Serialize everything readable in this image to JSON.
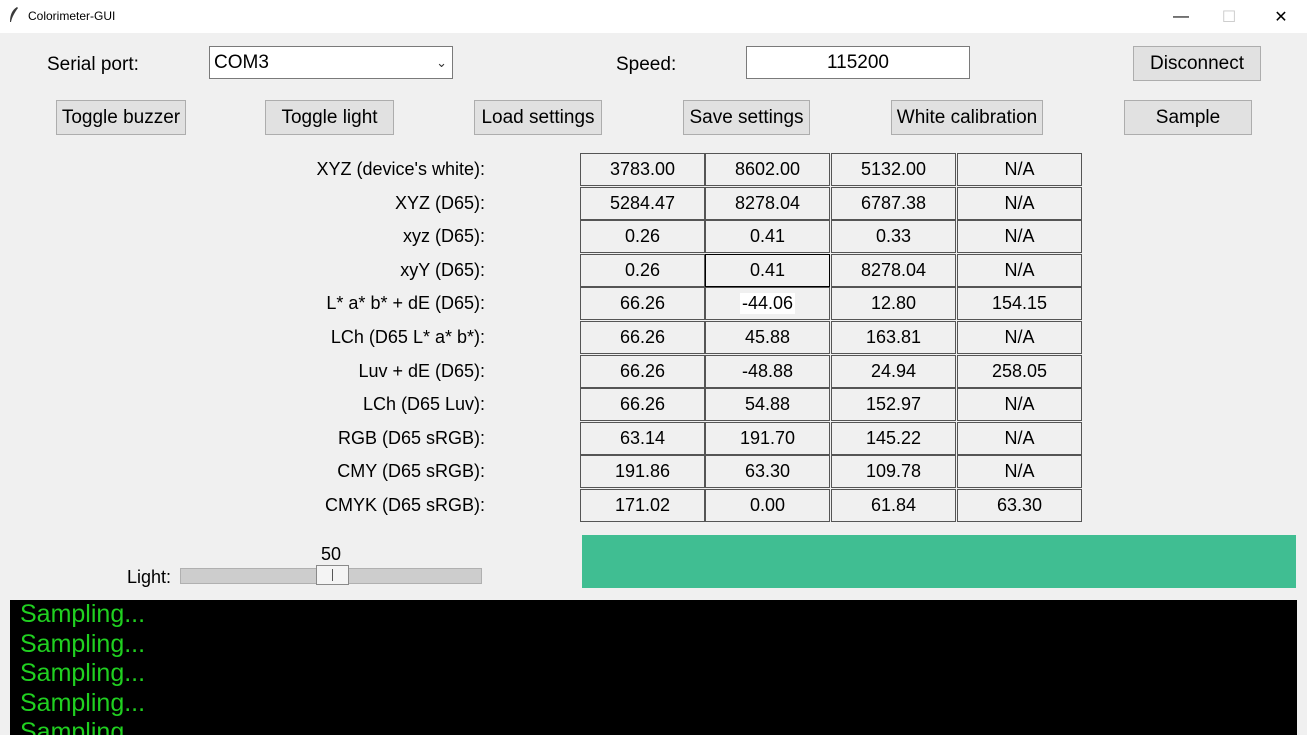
{
  "window": {
    "title": "Colorimeter-GUI",
    "minimize": "—",
    "maximize": "☐",
    "close": "✕"
  },
  "connection": {
    "serial_label": "Serial port:",
    "serial_value": "COM3",
    "speed_label": "Speed:",
    "speed_value": "115200",
    "disconnect": "Disconnect"
  },
  "buttons": {
    "toggle_buzzer": "Toggle buzzer",
    "toggle_light": "Toggle light",
    "load_settings": "Load settings",
    "save_settings": "Save settings",
    "white_calibration": "White calibration",
    "sample": "Sample"
  },
  "grid": {
    "rows": [
      {
        "label": "XYZ (device's white):",
        "values": [
          "3783.00",
          "8602.00",
          "5132.00",
          "N/A"
        ]
      },
      {
        "label": "XYZ (D65):",
        "values": [
          "5284.47",
          "8278.04",
          "6787.38",
          "N/A"
        ]
      },
      {
        "label": "xyz (D65):",
        "values": [
          "0.26",
          "0.41",
          "0.33",
          "N/A"
        ]
      },
      {
        "label": "xyY (D65):",
        "values": [
          "0.26",
          "0.41",
          "8278.04",
          "N/A"
        ]
      },
      {
        "label": "L* a* b* + dE (D65):",
        "values": [
          "66.26",
          "-44.06",
          "12.80",
          "154.15"
        ]
      },
      {
        "label": "LCh (D65 L* a* b*):",
        "values": [
          "66.26",
          "45.88",
          "163.81",
          "N/A"
        ]
      },
      {
        "label": "Luv + dE (D65):",
        "values": [
          "66.26",
          "-48.88",
          "24.94",
          "258.05"
        ]
      },
      {
        "label": "LCh (D65 Luv):",
        "values": [
          "66.26",
          "54.88",
          "152.97",
          "N/A"
        ]
      },
      {
        "label": "RGB (D65 sRGB):",
        "values": [
          "63.14",
          "191.70",
          "145.22",
          "N/A"
        ]
      },
      {
        "label": "CMY (D65 sRGB):",
        "values": [
          "191.86",
          "63.30",
          "109.78",
          "N/A"
        ]
      },
      {
        "label": "CMYK (D65 sRGB):",
        "values": [
          "171.02",
          "0.00",
          "61.84",
          "63.30"
        ]
      }
    ]
  },
  "light": {
    "label": "Light:",
    "value": "50",
    "level_fraction": 0.5
  },
  "swatch": {
    "color": "#40be92"
  },
  "console": {
    "lines": [
      "Sampling...",
      "Sampling...",
      "Sampling...",
      "Sampling...",
      "Sampling..."
    ]
  }
}
